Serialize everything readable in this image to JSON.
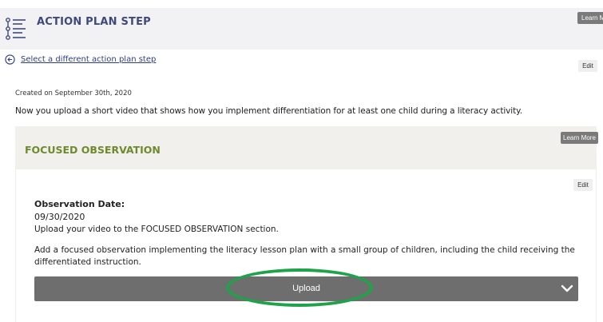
{
  "header": {
    "title": "ACTION PLAN STEP",
    "learn_more_label": "Learn More",
    "icon": "list-steps-icon"
  },
  "nav": {
    "back_link": "Select a different action plan step",
    "back_icon": "arrow-left-circle-icon",
    "edit_label": "Edit"
  },
  "step": {
    "created": "Created on September 30th, 2020",
    "instructions": "Now you upload a short video that shows how you implement differentiation for at least one child during a literacy activity."
  },
  "focused_observation": {
    "title": "FOCUSED OBSERVATION",
    "learn_more_label": "Learn More",
    "edit_label": "Edit",
    "date_label": "Observation Date:",
    "date_value": "09/30/2020",
    "upload_note": "Upload your video to the FOCUSED OBSERVATION section.",
    "description": "Add a focused observation implementing the literacy lesson plan with a small group of children, including the child receiving the differentiated instruction.",
    "upload_label": "Upload",
    "chevron_icon": "chevron-down-icon"
  },
  "colors": {
    "header_title": "#3f4a7c",
    "section_title": "#6d8a2d",
    "upload_bar": "#6e6e6e",
    "highlight": "#1fa34a"
  }
}
